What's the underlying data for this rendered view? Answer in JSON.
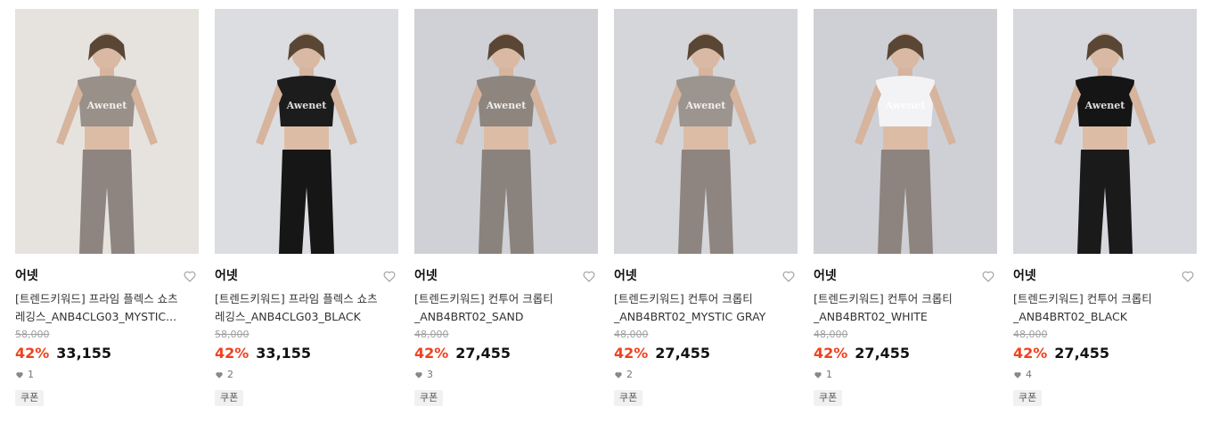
{
  "products": [
    {
      "brand": "어넷",
      "name_line1": "[트렌드키워드] 프라임 플렉스 쇼츠",
      "name_line2": "레깅스_ANB4CLG03_MYSTIC...",
      "original_price": "58,000",
      "discount": "42%",
      "price": "33,155",
      "likes": "1",
      "coupon": "쿠폰",
      "photo_bg": "#e6e3de",
      "top_color": "#9a908a",
      "bottom_color": "#8f8580"
    },
    {
      "brand": "어넷",
      "name_line1": "[트렌드키워드] 프라임 플렉스 쇼츠",
      "name_line2": "레깅스_ANB4CLG03_BLACK",
      "original_price": "58,000",
      "discount": "42%",
      "price": "33,155",
      "likes": "2",
      "coupon": "쿠폰",
      "photo_bg": "#dcdde0",
      "top_color": "#1c1c1c",
      "bottom_color": "#161616"
    },
    {
      "brand": "어넷",
      "name_line1": "[트렌드키워드] 컨투어 크롭티",
      "name_line2": "_ANB4BRT02_SAND",
      "original_price": "48,000",
      "discount": "42%",
      "price": "27,455",
      "likes": "3",
      "coupon": "쿠폰",
      "photo_bg": "#cfd1d6",
      "top_color": "#8d857e",
      "bottom_color": "#8a827c"
    },
    {
      "brand": "어넷",
      "name_line1": "[트렌드키워드] 컨투어 크롭티",
      "name_line2": "_ANB4BRT02_MYSTIC GRAY",
      "original_price": "48,000",
      "discount": "42%",
      "price": "27,455",
      "likes": "2",
      "coupon": "쿠폰",
      "photo_bg": "#d5d6da",
      "top_color": "#9c948e",
      "bottom_color": "#8e8580"
    },
    {
      "brand": "어넷",
      "name_line1": "[트렌드키워드] 컨투어 크롭티",
      "name_line2": "_ANB4BRT02_WHITE",
      "original_price": "48,000",
      "discount": "42%",
      "price": "27,455",
      "likes": "1",
      "coupon": "쿠폰",
      "photo_bg": "#cfd0d6",
      "top_color": "#f3f3f5",
      "bottom_color": "#8d847f"
    },
    {
      "brand": "어넷",
      "name_line1": "[트렌드키워드] 컨투어 크롭티",
      "name_line2": "_ANB4BRT02_BLACK",
      "original_price": "48,000",
      "discount": "42%",
      "price": "27,455",
      "likes": "4",
      "coupon": "쿠폰",
      "photo_bg": "#d6d8de",
      "top_color": "#151515",
      "bottom_color": "#1a1a1a"
    }
  ],
  "photo_logo": "Awenet"
}
